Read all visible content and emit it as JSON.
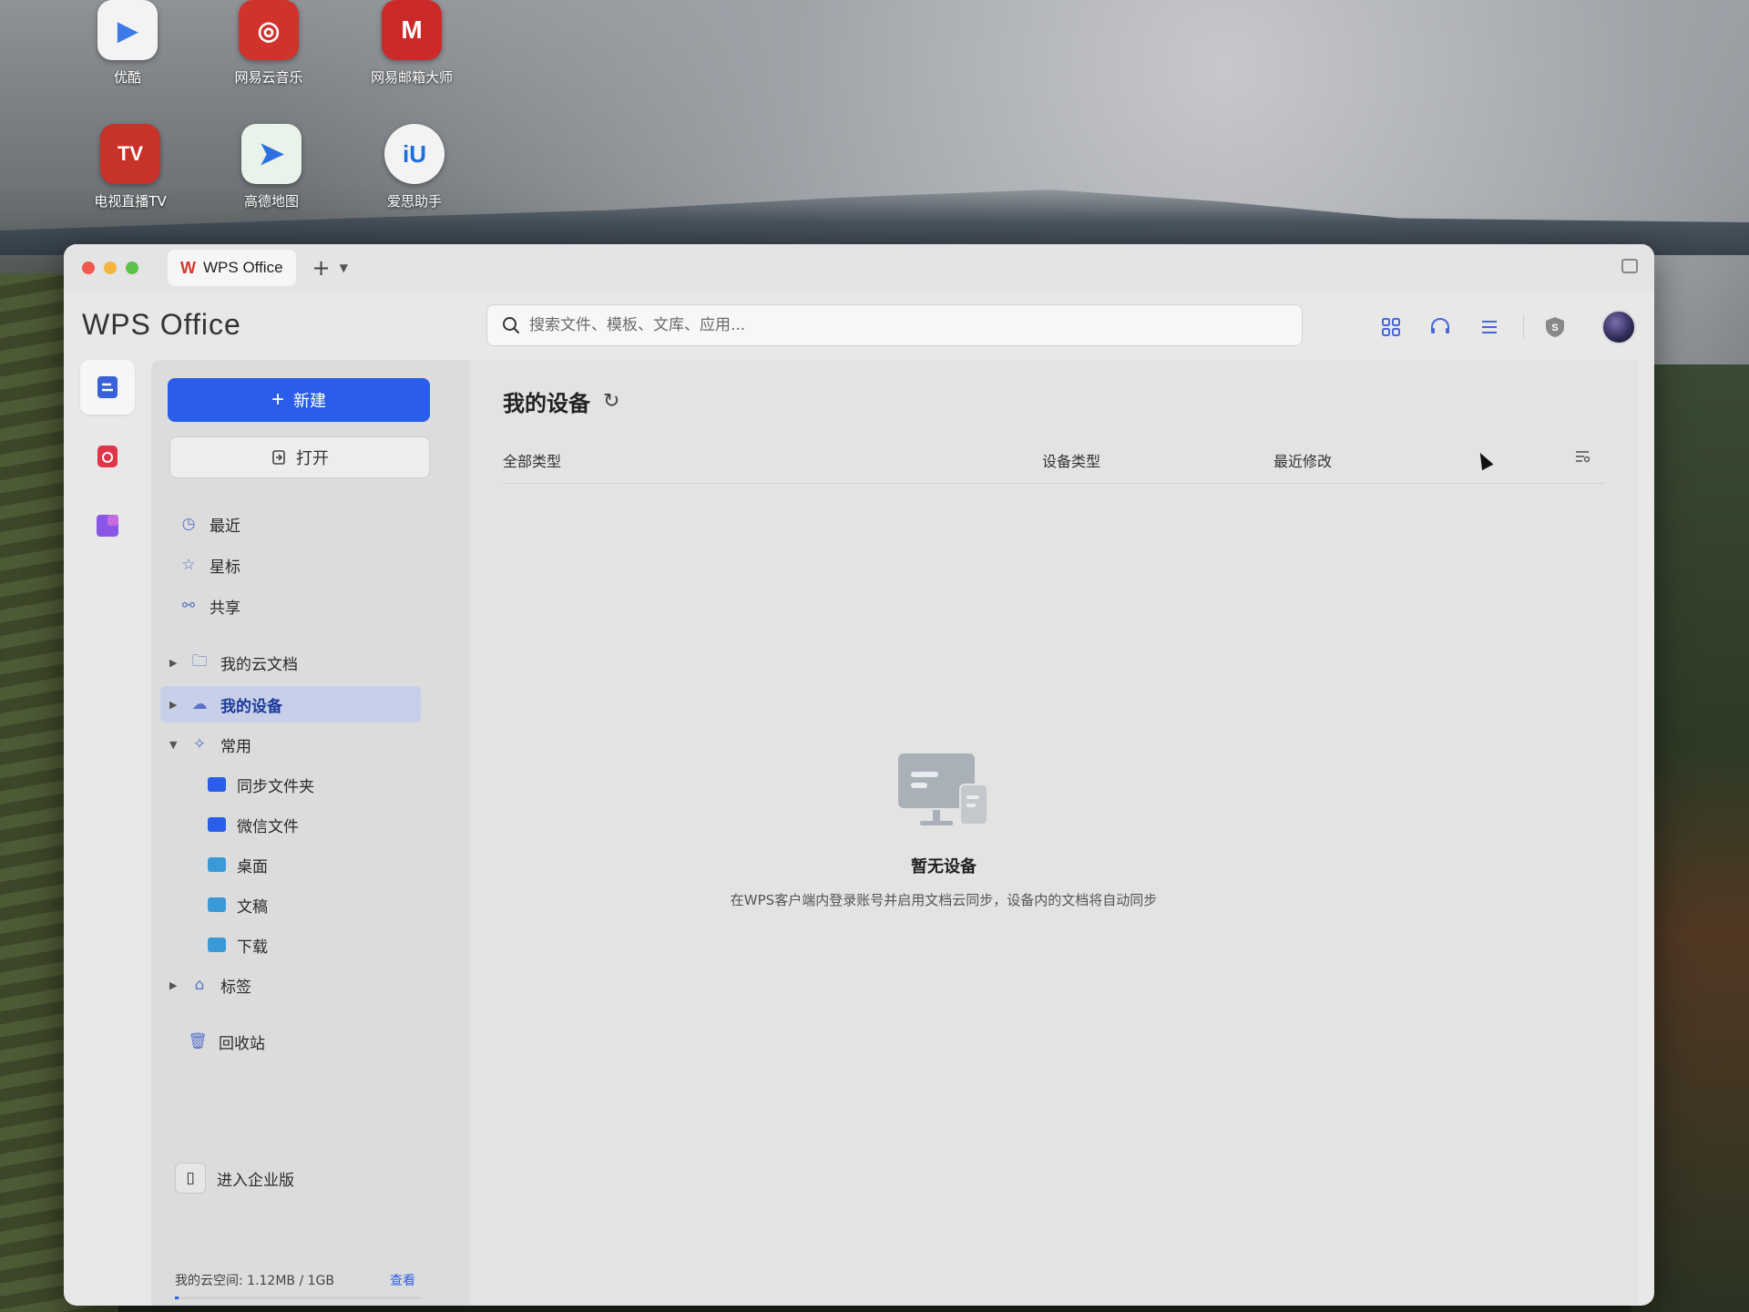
{
  "desktop": {
    "icons": [
      {
        "label": "优酷",
        "color": "#3e7ae6",
        "glyph": "▶"
      },
      {
        "label": "网易云音乐",
        "color": "#d0322c",
        "glyph": "◎"
      },
      {
        "label": "网易邮箱大师",
        "color": "#cc2a2a",
        "glyph": "M"
      },
      {
        "label": "电视直播TV",
        "color": "#c7332a",
        "glyph": "TV"
      },
      {
        "label": "高德地图",
        "color": "#3b8fe6",
        "glyph": "➤"
      },
      {
        "label": "爱思助手",
        "color": "#1d6fe0",
        "glyph": "iU"
      }
    ]
  },
  "window": {
    "tab_label": "WPS Office",
    "tab_logo": "W",
    "brand": "WPS Office",
    "search_placeholder": "搜索文件、模板、文库、应用..."
  },
  "nav": {
    "new_label": "新建",
    "open_label": "打开",
    "items": {
      "recent": "最近",
      "starred": "星标",
      "shared": "共享",
      "cloud_docs": "我的云文档",
      "my_devices": "我的设备",
      "common": "常用",
      "sync_folder": "同步文件夹",
      "wechat_files": "微信文件",
      "desktop": "桌面",
      "documents": "文稿",
      "downloads": "下载",
      "tags": "标签",
      "trash": "回收站",
      "enterprise": "进入企业版"
    },
    "storage_text": "我的云空间: 1.12MB / 1GB",
    "storage_link": "查看",
    "storage_used_fraction": 0.0011
  },
  "main": {
    "title": "我的设备",
    "columns": {
      "all_types": "全部类型",
      "device_type": "设备类型",
      "last_modified": "最近修改"
    },
    "empty_title": "暂无设备",
    "empty_desc": "在WPS客户端内登录账号并启用文档云同步，设备内的文档将自动同步"
  },
  "colors": {
    "accent": "#2a5ee8",
    "selected_bg": "#c7d0e8"
  }
}
